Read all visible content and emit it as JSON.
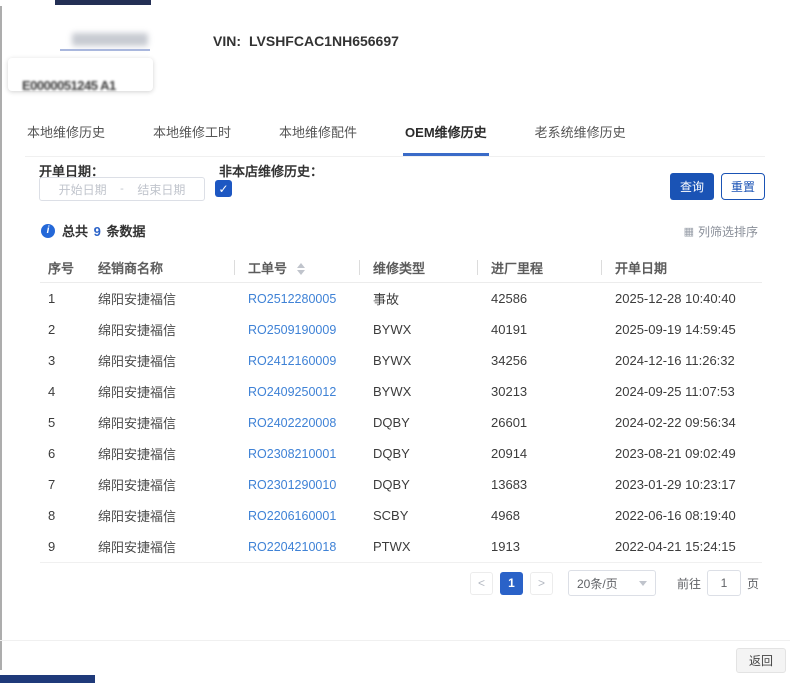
{
  "header": {
    "vin_label": "VIN:",
    "vin_value": "LVSHFCAC1NH656697",
    "masked_code": "E0000051245 A1"
  },
  "tabs": [
    {
      "label": "本地维修历史",
      "active": false
    },
    {
      "label": "本地维修工时",
      "active": false
    },
    {
      "label": "本地维修配件",
      "active": false
    },
    {
      "label": "OEM维修历史",
      "active": true
    },
    {
      "label": "老系统维修历史",
      "active": false
    }
  ],
  "filters": {
    "date_label": "开单日期：",
    "start_placeholder": "开始日期",
    "range_separator": "-",
    "end_placeholder": "结束日期",
    "nonlocal_label": "非本店维修历史：",
    "checkbox_checked": true,
    "checkbox_glyph": "✓",
    "search_label": "查询",
    "reset_label": "重置"
  },
  "summary": {
    "prefix": "总共",
    "count": "9",
    "suffix": "条数据",
    "column_tool_label": "列筛选排序",
    "column_tool_icon": "▦"
  },
  "table": {
    "columns": [
      "序号",
      "经销商名称",
      "工单号",
      "维修类型",
      "进厂里程",
      "开单日期"
    ],
    "rows": [
      {
        "seq": "1",
        "dealer": "绵阳安捷福信",
        "order_no": "RO2512280005",
        "type": "事故",
        "mileage": "42586",
        "date": "2025-12-28 10:40:40"
      },
      {
        "seq": "2",
        "dealer": "绵阳安捷福信",
        "order_no": "RO2509190009",
        "type": "BYWX",
        "mileage": "40191",
        "date": "2025-09-19 14:59:45"
      },
      {
        "seq": "3",
        "dealer": "绵阳安捷福信",
        "order_no": "RO2412160009",
        "type": "BYWX",
        "mileage": "34256",
        "date": "2024-12-16 11:26:32"
      },
      {
        "seq": "4",
        "dealer": "绵阳安捷福信",
        "order_no": "RO2409250012",
        "type": "BYWX",
        "mileage": "30213",
        "date": "2024-09-25 11:07:53"
      },
      {
        "seq": "5",
        "dealer": "绵阳安捷福信",
        "order_no": "RO2402220008",
        "type": "DQBY",
        "mileage": "26601",
        "date": "2024-02-22 09:56:34"
      },
      {
        "seq": "6",
        "dealer": "绵阳安捷福信",
        "order_no": "RO2308210001",
        "type": "DQBY",
        "mileage": "20914",
        "date": "2023-08-21 09:02:49"
      },
      {
        "seq": "7",
        "dealer": "绵阳安捷福信",
        "order_no": "RO2301290010",
        "type": "DQBY",
        "mileage": "13683",
        "date": "2023-01-29 10:23:17"
      },
      {
        "seq": "8",
        "dealer": "绵阳安捷福信",
        "order_no": "RO2206160001",
        "type": "SCBY",
        "mileage": "4968",
        "date": "2022-06-16 08:19:40"
      },
      {
        "seq": "9",
        "dealer": "绵阳安捷福信",
        "order_no": "RO2204210018",
        "type": "PTWX",
        "mileage": "1913",
        "date": "2022-04-21 15:24:15"
      }
    ]
  },
  "pagination": {
    "prev_label": "<",
    "current_page": "1",
    "next_label": ">",
    "page_size": "20条/页",
    "goto_label": "前往",
    "goto_value": "1",
    "page_unit": "页"
  },
  "footer": {
    "back_label": "返回"
  },
  "colors": {
    "accent": "#2a62c8",
    "primary_button": "#1a53b5",
    "link": "#3f82d6",
    "tab_underline": "#3a6bc8",
    "checkbox": "#1d57c2"
  }
}
